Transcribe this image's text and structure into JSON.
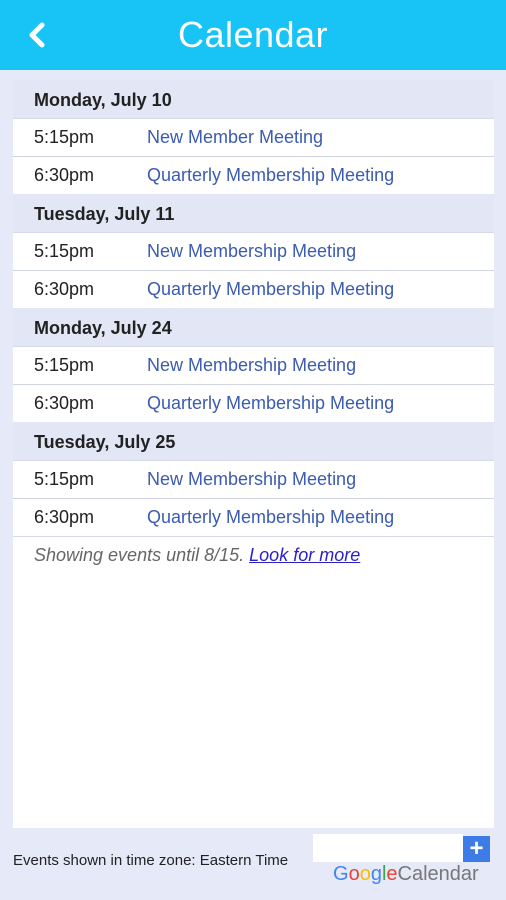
{
  "header": {
    "title": "Calendar",
    "back_icon": "chevron-left-icon"
  },
  "days": [
    {
      "date": "Monday, July 10",
      "events": [
        {
          "time": "5:15pm",
          "title": "New Member Meeting"
        },
        {
          "time": "6:30pm",
          "title": "Quarterly Membership Meeting"
        }
      ]
    },
    {
      "date": "Tuesday, July 11",
      "events": [
        {
          "time": "5:15pm",
          "title": "New Membership Meeting"
        },
        {
          "time": "6:30pm",
          "title": "Quarterly Membership Meeting"
        }
      ]
    },
    {
      "date": "Monday, July 24",
      "events": [
        {
          "time": "5:15pm",
          "title": "New Membership Meeting"
        },
        {
          "time": "6:30pm",
          "title": "Quarterly Membership Meeting"
        }
      ]
    },
    {
      "date": "Tuesday, July 25",
      "events": [
        {
          "time": "5:15pm",
          "title": "New Membership Meeting"
        },
        {
          "time": "6:30pm",
          "title": "Quarterly Membership Meeting"
        }
      ]
    }
  ],
  "showing": {
    "text": "Showing events until 8/15.",
    "link": "Look for more"
  },
  "footer": {
    "timezone": "Events shown in time zone: Eastern Time",
    "plus_label": "+",
    "logo": {
      "g1": "G",
      "o1": "o",
      "o2": "o",
      "g2": "g",
      "l": "l",
      "e": "e",
      "calendar": "Calendar"
    }
  },
  "colors": {
    "header": "#18c4f5",
    "link": "#3b5bb0",
    "background": "#e6e9f8"
  }
}
